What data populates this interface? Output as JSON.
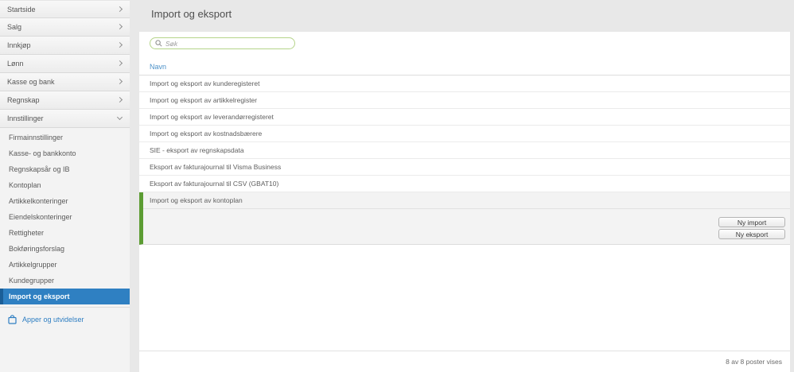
{
  "sidebar": {
    "top_items": [
      {
        "label": "Startside"
      },
      {
        "label": "Salg"
      },
      {
        "label": "Innkjøp"
      },
      {
        "label": "Lønn"
      },
      {
        "label": "Kasse og bank"
      },
      {
        "label": "Regnskap"
      },
      {
        "label": "Innstillinger"
      }
    ],
    "sub_items": [
      "Firmainnstillinger",
      "Kasse- og bankkonto",
      "Regnskapsår og IB",
      "Kontoplan",
      "Artikkelkonteringer",
      "Eiendelskonteringer",
      "Rettigheter",
      "Bokføringsforslag",
      "Artikkelgrupper",
      "Kundegrupper",
      "Import og eksport"
    ],
    "selected_sub_item": "Import og eksport",
    "apps_link": "Apper og utvidelser"
  },
  "main": {
    "title": "Import og eksport",
    "search": {
      "placeholder": "Søk"
    },
    "table": {
      "column_header": "Navn",
      "rows": [
        "Import og eksport av kunderegisteret",
        "Import og eksport av artikkelregister",
        "Import og eksport av leverandørregisteret",
        "Import og eksport av kostnadsbærere",
        "SIE - eksport av regnskapsdata",
        "Eksport av fakturajournal til Visma Business",
        "Eksport av fakturajournal til CSV (GBAT10)"
      ],
      "selected_row": "Import og eksport av kontoplan"
    },
    "buttons": {
      "new_import": "Ny import",
      "new_export": "Ny eksport"
    },
    "footer": {
      "status": "8 av 8 poster vises"
    }
  },
  "colors": {
    "accent_blue": "#2f80c2",
    "selected_green": "#5c9c33",
    "search_border_green": "#b5d48a",
    "header_link_blue": "#4a90c8"
  }
}
